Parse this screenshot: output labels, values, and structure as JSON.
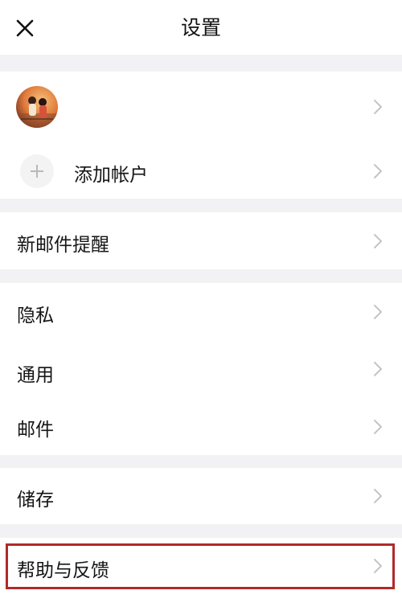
{
  "header": {
    "title": "设置"
  },
  "accounts": {
    "add_account_label": "添加帐户"
  },
  "menu": {
    "new_mail_alert": "新邮件提醒",
    "privacy": "隐私",
    "general": "通用",
    "mail": "邮件",
    "storage": "储存",
    "help_feedback": "帮助与反馈"
  },
  "icons": {
    "close": "close-icon",
    "chevron": "chevron-right-icon",
    "add": "plus-icon"
  },
  "colors": {
    "highlight_border": "#b02a2a",
    "background": "#f2f2f4",
    "chevron": "#c4c4c8"
  }
}
